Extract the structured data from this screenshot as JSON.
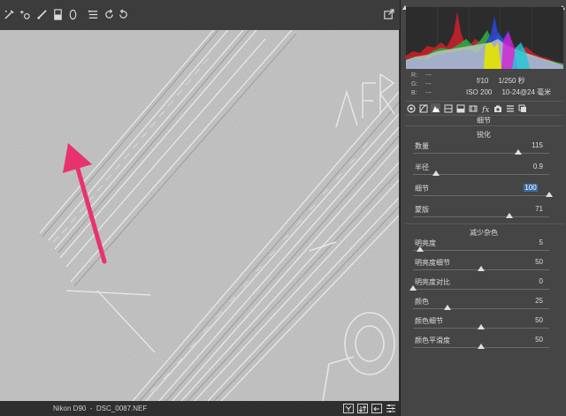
{
  "toolbar": {
    "tools": [
      "adjustment-brush-icon",
      "spot-removal-icon",
      "brush-icon",
      "graduated-filter-icon",
      "radial-filter-icon",
      "presets-list-icon",
      "rotate-ccw-icon",
      "rotate-cw-icon",
      "export-icon"
    ]
  },
  "status": {
    "filename": "Nikon D90  -  DSC_0087.NEF"
  },
  "bottom_buttons": [
    "y-compare-icon",
    "swap-icon",
    "copy-settings-icon",
    "settings-menu-icon"
  ],
  "readout": {
    "r_label": "R:",
    "g_label": "G:",
    "b_label": "B:",
    "r_value": "---",
    "g_value": "---",
    "b_value": "---",
    "camera_line1": "f/10     1/250 秒",
    "camera_line2": "ISO 200     10-24@24 毫米"
  },
  "panel": {
    "section_title": "细节",
    "sharpen": {
      "title": "锐化",
      "sliders": [
        {
          "label": "数量",
          "value": "115",
          "fraction": 0.77
        },
        {
          "label": "半径",
          "value": "0.9",
          "fraction": 0.17
        },
        {
          "label": "细节",
          "value": "100",
          "fraction": 1.0,
          "active": true
        },
        {
          "label": "蒙版",
          "value": "71",
          "fraction": 0.71
        }
      ]
    },
    "noise": {
      "title": "减少杂色",
      "sliders": [
        {
          "label": "明亮度",
          "value": "5",
          "fraction": 0.05
        },
        {
          "label": "明亮度细节",
          "value": "50",
          "fraction": 0.5
        },
        {
          "label": "明亮度对比",
          "value": "0",
          "fraction": 0.0
        },
        {
          "label": "颜色",
          "value": "25",
          "fraction": 0.25
        },
        {
          "label": "颜色细节",
          "value": "50",
          "fraction": 0.5
        },
        {
          "label": "颜色平滑度",
          "value": "50",
          "fraction": 0.5
        }
      ]
    }
  },
  "colors": {
    "accent": "#e8326e",
    "active_value_bg": "#3a6ea5"
  }
}
